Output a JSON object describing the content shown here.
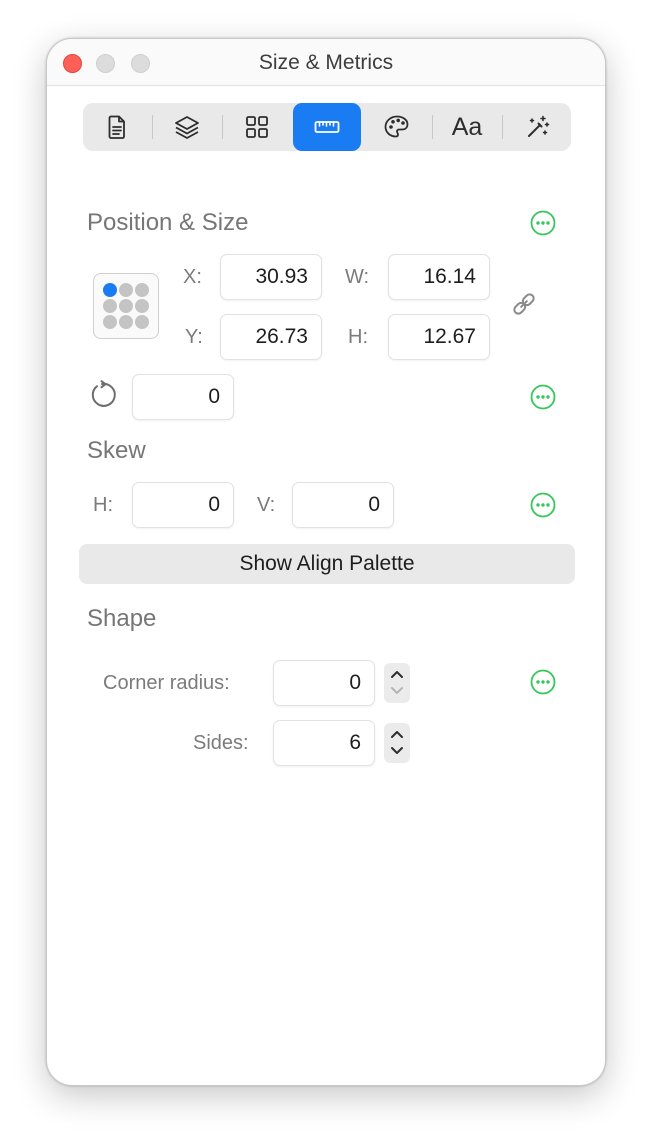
{
  "window": {
    "title": "Size & Metrics"
  },
  "toolbar": {
    "tabs": [
      {
        "icon": "document-icon"
      },
      {
        "icon": "layers-icon"
      },
      {
        "icon": "grid-icon"
      },
      {
        "icon": "ruler-icon",
        "active": true
      },
      {
        "icon": "palette-icon"
      },
      {
        "icon": "text-icon",
        "label": "Aa"
      },
      {
        "icon": "magic-wand-icon"
      }
    ],
    "accent": "#1a7cf3"
  },
  "position_size": {
    "heading": "Position & Size",
    "x_label": "X:",
    "x_value": "30.93",
    "y_label": "Y:",
    "y_value": "26.73",
    "w_label": "W:",
    "w_value": "16.14",
    "h_label": "H:",
    "h_value": "12.67",
    "rotation_value": "0"
  },
  "skew": {
    "heading": "Skew",
    "h_label": "H:",
    "h_value": "0",
    "v_label": "V:",
    "v_value": "0"
  },
  "align_button": {
    "label": "Show Align Palette"
  },
  "shape": {
    "heading": "Shape",
    "corner_label": "Corner radius:",
    "corner_value": "0",
    "sides_label": "Sides:",
    "sides_value": "6"
  },
  "colors": {
    "more_green": "#34c759",
    "close_red": "#fe5f57"
  }
}
